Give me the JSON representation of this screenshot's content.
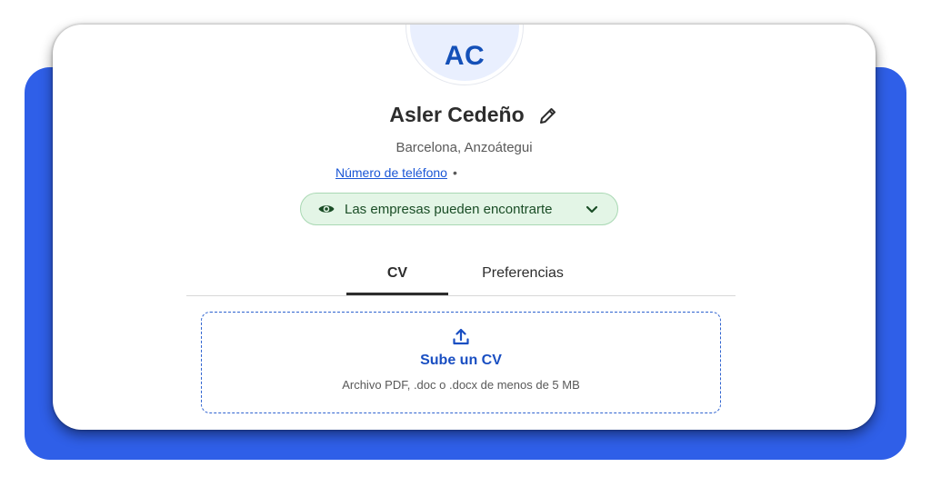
{
  "profile": {
    "initials": "AC",
    "name": "Asler Cedeño",
    "location": "Barcelona, Anzoátegui",
    "phone_link": "Número de teléfono",
    "phone_separator": "•"
  },
  "visibility": {
    "label": "Las empresas pueden encontrarte",
    "icon": "eye-icon",
    "chevron": "chevron-down-icon"
  },
  "tabs": [
    {
      "label": "CV",
      "active": true
    },
    {
      "label": "Preferencias",
      "active": false
    }
  ],
  "upload": {
    "title": "Sube un CV",
    "hint": "Archivo PDF, .doc o .docx de menos de 5 MB",
    "icon": "upload-icon"
  },
  "colors": {
    "backdrop": "#2f5fe8",
    "accent": "#1a4fc2",
    "pill_bg": "#e3f5e6",
    "pill_border": "#a9d8b3"
  }
}
